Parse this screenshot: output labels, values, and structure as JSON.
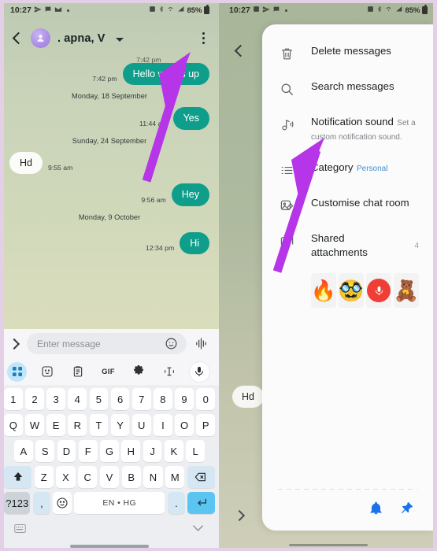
{
  "status_bar": {
    "time": "10:27",
    "battery": "85%",
    "left_icons": [
      "send-icon",
      "messages-icon",
      "mail-icon",
      "dot-icon"
    ],
    "right_icons": [
      "screenshot-icon",
      "bluetooth-icon",
      "wifi-icon",
      "signal-icon"
    ]
  },
  "left_phone": {
    "header": {
      "title": ". apna, V",
      "back": "back-chevron",
      "menu": "overflow-menu"
    },
    "messages": [
      {
        "type": "out",
        "text": "Hello what's up",
        "time": "7:42 pm",
        "clipped": false
      },
      {
        "type": "daysep",
        "text": "Monday, 18 September"
      },
      {
        "type": "out",
        "text": "Yes",
        "time": "11:44 am"
      },
      {
        "type": "daysep",
        "text": "Sunday, 24 September"
      },
      {
        "type": "in",
        "text": "Hd",
        "time": "9:55 am"
      },
      {
        "type": "out",
        "text": "Hey",
        "time": "9:56 am"
      },
      {
        "type": "daysep",
        "text": "Monday, 9 October"
      },
      {
        "type": "out",
        "text": "Hi",
        "time": "12:34 pm"
      }
    ],
    "input": {
      "placeholder": "Enter message",
      "emoji_icon": "emoji-icon",
      "voice_icon": "audio-waveform-icon"
    },
    "toolbar": [
      {
        "name": "apps-grid-icon",
        "label": ""
      },
      {
        "name": "sticker-icon",
        "label": ""
      },
      {
        "name": "clipboard-icon",
        "label": ""
      },
      {
        "name": "gif-icon",
        "label": "GIF"
      },
      {
        "name": "settings-gear-icon",
        "label": ""
      },
      {
        "name": "text-edit-icon",
        "label": ""
      },
      {
        "name": "microphone-icon",
        "label": ""
      }
    ],
    "keyboard": {
      "row1": [
        "1",
        "2",
        "3",
        "4",
        "5",
        "6",
        "7",
        "8",
        "9",
        "0"
      ],
      "row2": [
        "Q",
        "W",
        "E",
        "R",
        "T",
        "Y",
        "U",
        "I",
        "O",
        "P"
      ],
      "row3": [
        "A",
        "S",
        "D",
        "F",
        "G",
        "H",
        "J",
        "K",
        "L"
      ],
      "row4": [
        "Z",
        "X",
        "C",
        "V",
        "B",
        "N",
        "M"
      ],
      "shift": "shift-icon",
      "backspace": "backspace-icon",
      "symbols": "?123",
      "comma": ",",
      "emoji": "emoji-key-icon",
      "space": "EN • HG",
      "period": ".",
      "enter": "enter-icon"
    },
    "nav": {
      "keyboard_switch": "keyboard-layout-icon",
      "hide_keyboard": "chevron-down-icon"
    }
  },
  "right_phone": {
    "back": "back-chevron",
    "ghost_bubble": "Hd",
    "menu_items": [
      {
        "icon": "trash-icon",
        "label": "Delete messages",
        "sub": "",
        "count": ""
      },
      {
        "icon": "search-icon",
        "label": "Search messages",
        "sub": "",
        "count": ""
      },
      {
        "icon": "notification-sound-icon",
        "label": "Notification sound",
        "sub": "Set a custom notification sound.",
        "count": ""
      },
      {
        "icon": "category-list-icon",
        "label": "Category",
        "sub": "Personal",
        "count": ""
      },
      {
        "icon": "customise-chat-icon",
        "label": "Customise chat room",
        "sub": "",
        "count": ""
      },
      {
        "icon": "shared-attachments-icon",
        "label": "Shared attachments",
        "sub": "",
        "count": "4"
      }
    ],
    "attachments": [
      {
        "name": "campfire-sticker-thumb",
        "glyph": "🔥"
      },
      {
        "name": "avatar-emoji-thumb",
        "glyph": "🥸"
      },
      {
        "name": "voice-recording-thumb",
        "glyph": ""
      },
      {
        "name": "bear-sticker-thumb",
        "glyph": "🧸"
      }
    ],
    "footer_icons": [
      {
        "name": "notification-bell-icon"
      },
      {
        "name": "pin-icon"
      }
    ]
  },
  "annotations": {
    "arrow_color": "#b635e8"
  },
  "colors": {
    "bubble_out": "#0f9e8b",
    "bubble_in": "#fbfcf8",
    "accent_blue": "#1a73e8",
    "category_blue": "#3e8fd6",
    "key_fn": "#d5e7f2",
    "enter_key": "#5bc5f2"
  }
}
